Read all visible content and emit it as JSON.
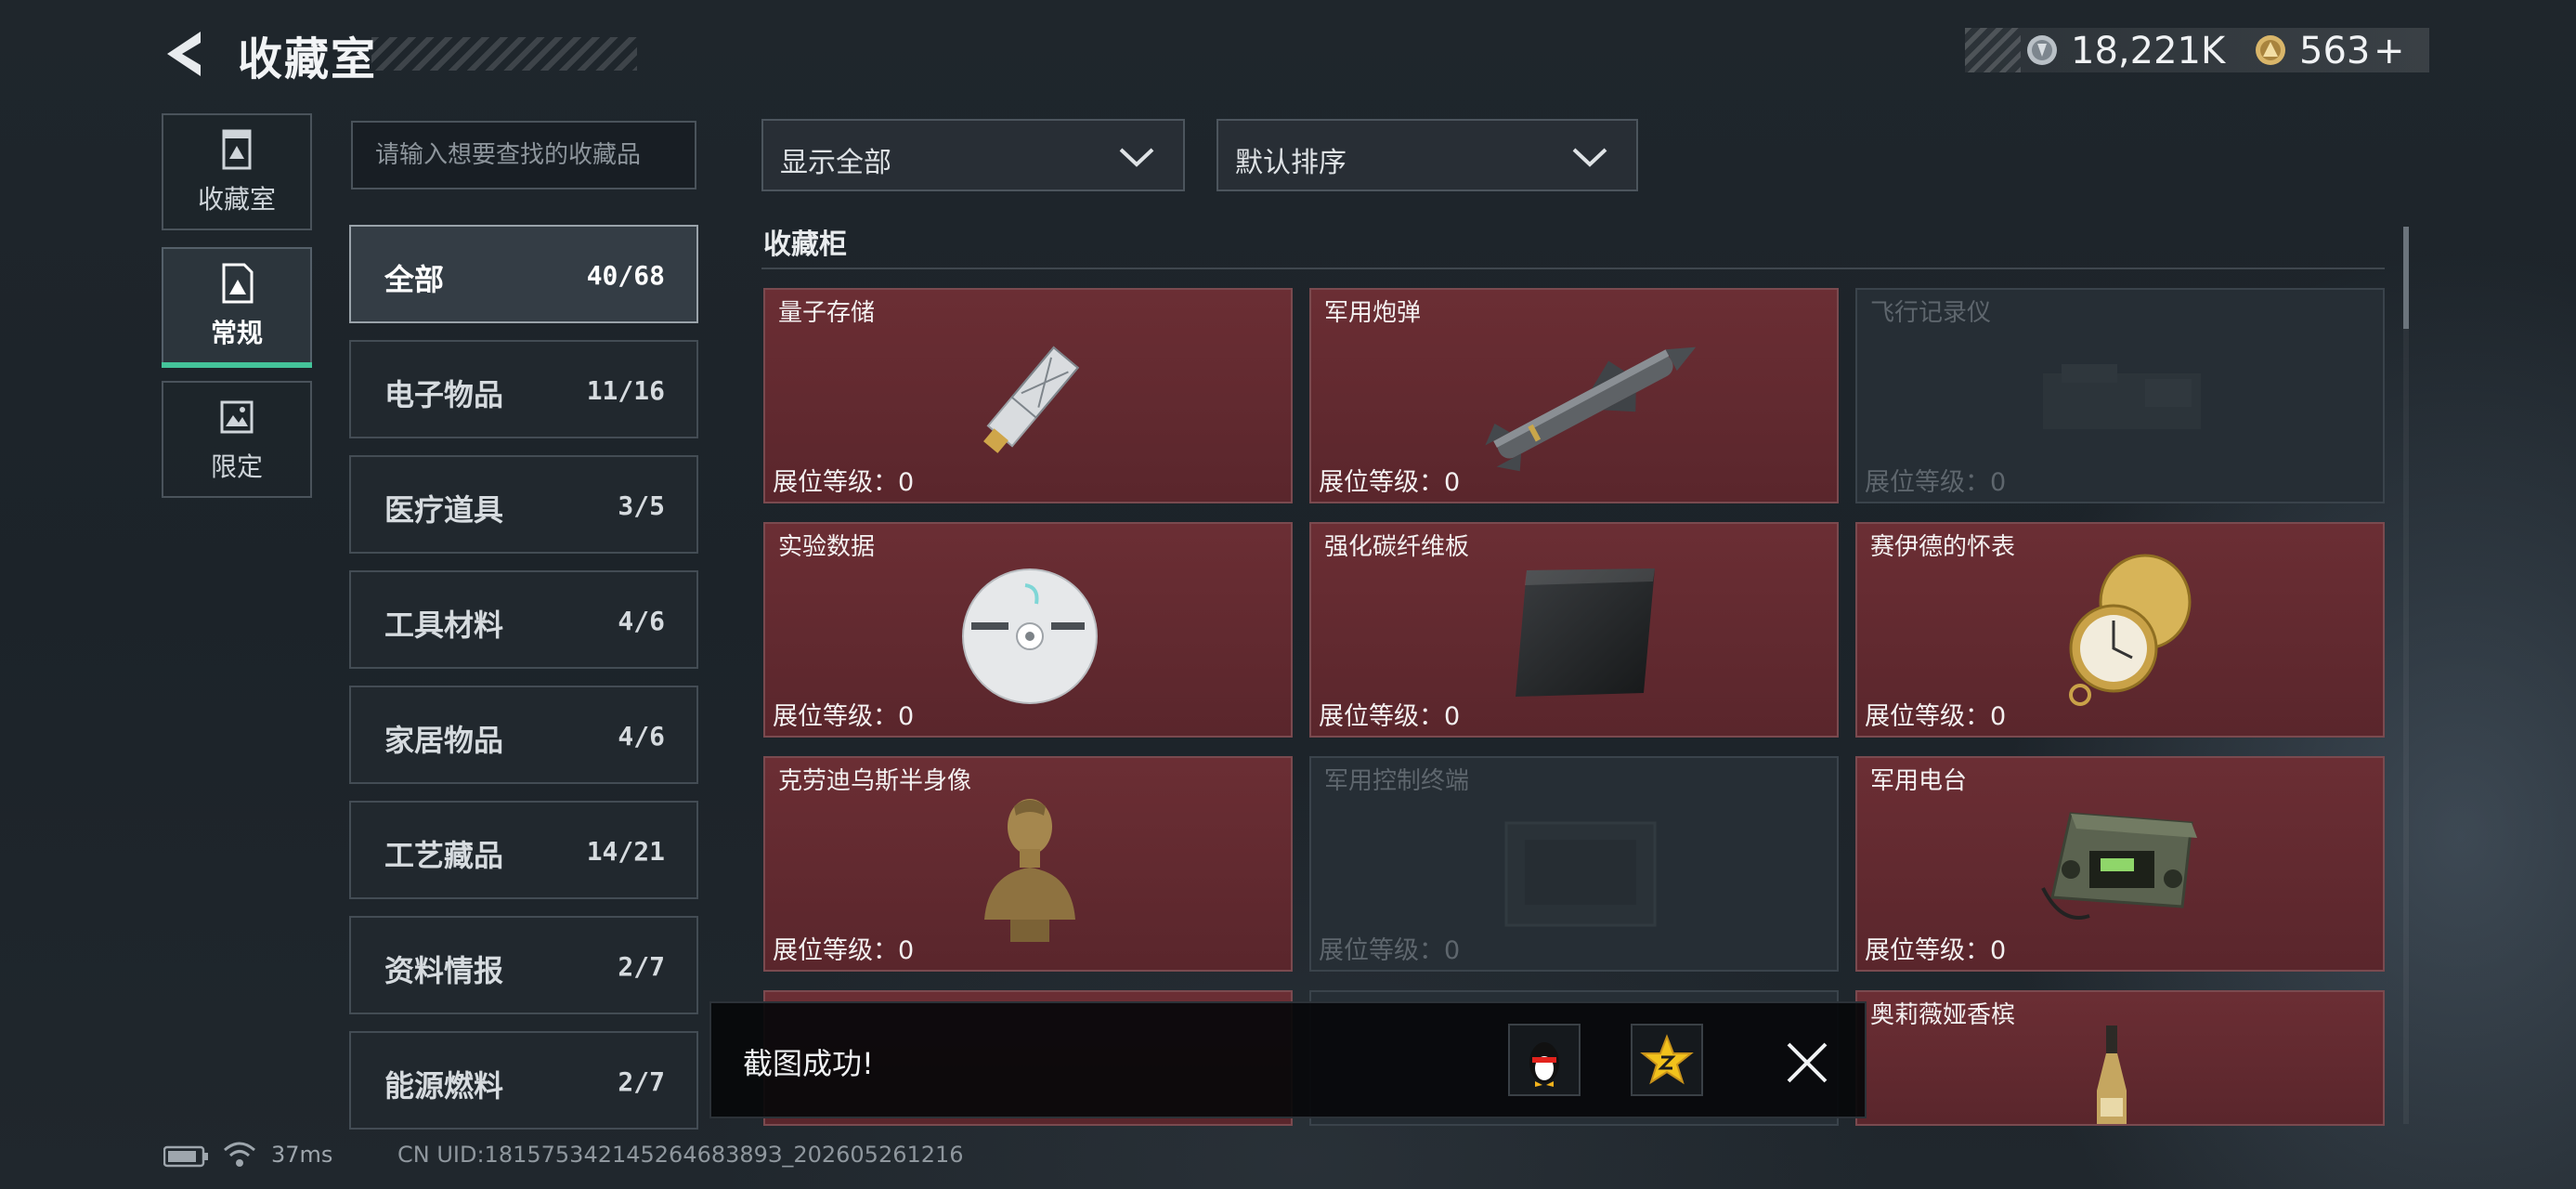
{
  "header": {
    "title": "收藏室",
    "currency": [
      {
        "icon": "silver-coin-icon",
        "value": "18,221K"
      },
      {
        "icon": "gold-coin-icon",
        "value": "563",
        "suffix": "+"
      }
    ]
  },
  "side_tabs": [
    {
      "label": "收藏室",
      "icon": "collection-room-icon",
      "active": false
    },
    {
      "label": "常规",
      "icon": "regular-icon",
      "active": true
    },
    {
      "label": "限定",
      "icon": "limited-icon",
      "active": false
    }
  ],
  "search": {
    "placeholder": "请输入想要查找的收藏品"
  },
  "categories": [
    {
      "name": "全部",
      "count": "40/68",
      "active": true
    },
    {
      "name": "电子物品",
      "count": "11/16"
    },
    {
      "name": "医疗道具",
      "count": "3/5"
    },
    {
      "name": "工具材料",
      "count": "4/6"
    },
    {
      "name": "家居物品",
      "count": "4/6"
    },
    {
      "name": "工艺藏品",
      "count": "14/21"
    },
    {
      "name": "资料情报",
      "count": "2/7"
    },
    {
      "name": "能源燃料",
      "count": "2/7"
    }
  ],
  "filters": {
    "show": "显示全部",
    "sort": "默认排序"
  },
  "section_title": "收藏柜",
  "items": [
    {
      "name": "量子存储",
      "level_label": "展位等级：",
      "level": "0",
      "owned": true,
      "icon": "usb-drive-icon"
    },
    {
      "name": "军用炮弹",
      "level_label": "展位等级：",
      "level": "0",
      "owned": true,
      "icon": "missile-icon"
    },
    {
      "name": "飞行记录仪",
      "level_label": "展位等级：",
      "level": "0",
      "owned": false,
      "icon": "flight-recorder-icon"
    },
    {
      "name": "实验数据",
      "level_label": "展位等级：",
      "level": "0",
      "owned": true,
      "icon": "cd-disc-icon"
    },
    {
      "name": "强化碳纤维板",
      "level_label": "展位等级：",
      "level": "0",
      "owned": true,
      "icon": "carbon-plate-icon"
    },
    {
      "name": "赛伊德的怀表",
      "level_label": "展位等级：",
      "level": "0",
      "owned": true,
      "icon": "pocket-watch-icon"
    },
    {
      "name": "克劳迪乌斯半身像",
      "level_label": "展位等级：",
      "level": "0",
      "owned": true,
      "icon": "bust-statue-icon"
    },
    {
      "name": "军用控制终端",
      "level_label": "展位等级：",
      "level": "0",
      "owned": false,
      "icon": "control-terminal-icon"
    },
    {
      "name": "军用电台",
      "level_label": "展位等级：",
      "level": "0",
      "owned": true,
      "icon": "military-radio-icon"
    },
    {
      "name": "",
      "owned": true,
      "icon": "laptop-icon"
    },
    {
      "name": "",
      "owned": false,
      "icon": "fossil-icon"
    },
    {
      "name": "奥莉薇娅香槟",
      "owned": true,
      "icon": "champagne-bottle-icon"
    }
  ],
  "toast": {
    "text": "截图成功!"
  },
  "status": {
    "ping": "37ms",
    "uid": "CN UID:18157534214526468389З_202605261216"
  }
}
